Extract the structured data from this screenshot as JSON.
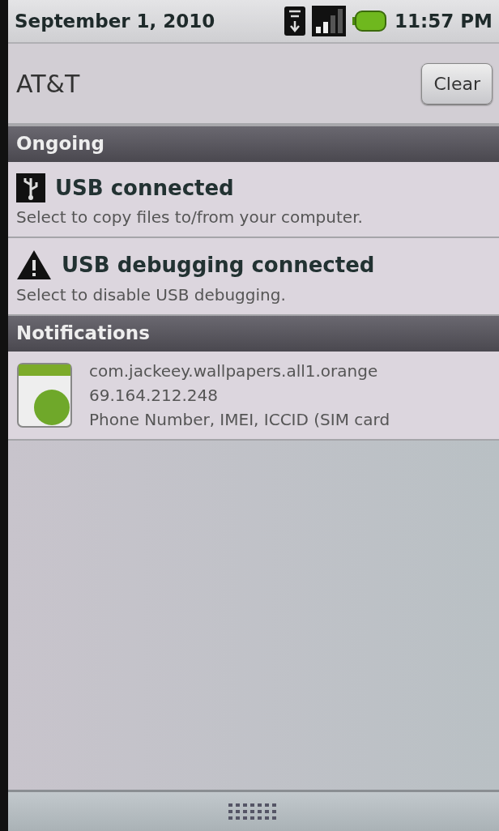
{
  "status_bar": {
    "date": "September 1, 2010",
    "time": "11:57 PM"
  },
  "header": {
    "carrier": "AT&T",
    "clear_button": "Clear"
  },
  "sections": [
    {
      "title": "Ongoing",
      "items": [
        {
          "kind": "usb",
          "title": "USB connected",
          "lines": [
            "Select to copy files to/from your computer."
          ]
        },
        {
          "kind": "warning",
          "title": "USB debugging connected",
          "lines": [
            "Select to disable USB debugging."
          ]
        }
      ]
    },
    {
      "title": "Notifications",
      "items": [
        {
          "kind": "app",
          "lines": [
            "com.jackeey.wallpapers.all1.orange",
            "69.164.212.248",
            "Phone Number, IMEI, ICCID (SIM card"
          ]
        }
      ]
    }
  ]
}
